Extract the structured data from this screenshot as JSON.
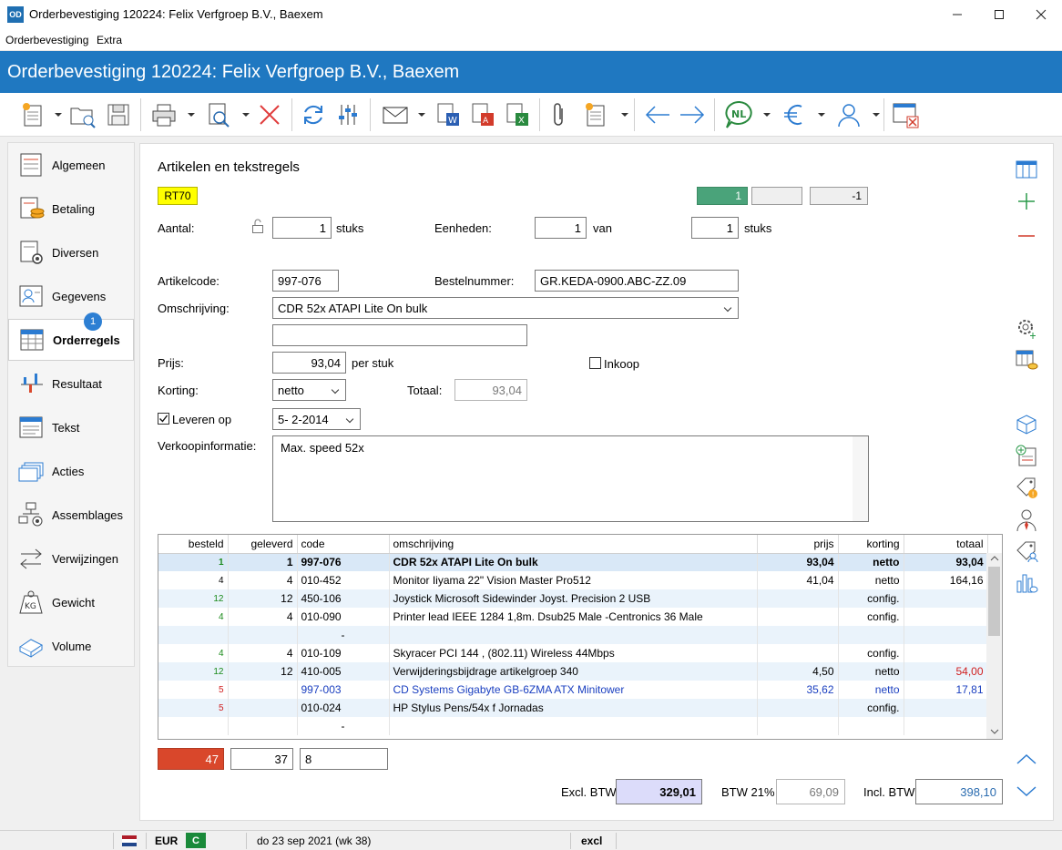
{
  "window": {
    "title": "Orderbevestiging 120224: Felix Verfgroep B.V., Baexem",
    "app_icon": "OD"
  },
  "menu": [
    "Orderbevestiging",
    "Extra"
  ],
  "banner": {
    "title": "Orderbevestiging 120224: Felix Verfgroep B.V., Baexem"
  },
  "toolbar": {
    "language": "NL"
  },
  "sidebar": {
    "items": [
      {
        "label": "Algemeen",
        "icon": "sheet-icon"
      },
      {
        "label": "Betaling",
        "icon": "coins-icon"
      },
      {
        "label": "Diversen",
        "icon": "gear-doc-icon"
      },
      {
        "label": "Gegevens",
        "icon": "contact-card-icon"
      },
      {
        "label": "Orderregels",
        "icon": "table-icon"
      },
      {
        "label": "Resultaat",
        "icon": "chart-icon"
      },
      {
        "label": "Tekst",
        "icon": "text-icon"
      },
      {
        "label": "Acties",
        "icon": "cards-icon"
      },
      {
        "label": "Assemblages",
        "icon": "assembly-icon"
      },
      {
        "label": "Verwijzingen",
        "icon": "arrows-icon"
      },
      {
        "label": "Gewicht",
        "icon": "weight-icon"
      },
      {
        "label": "Volume",
        "icon": "box-icon"
      }
    ],
    "badge": "1"
  },
  "form": {
    "section_title": "Artikelen en tekstregels",
    "tag": "RT70",
    "counters": {
      "current": "1",
      "middle": "",
      "last": "-1"
    },
    "aantal_label": "Aantal:",
    "aantal_value": "1",
    "stuks": "stuks",
    "eenheden_label": "Eenheden:",
    "eenheden_value": "1",
    "van": "van",
    "eenheden_of": "1",
    "artikelcode_label": "Artikelcode:",
    "artikelcode_value": "997-076",
    "bestelnummer_label": "Bestelnummer:",
    "bestelnummer_value": "GR.KEDA-0900.ABC-ZZ.09",
    "omschrijving_label": "Omschrijving:",
    "omschrijving_value": "CDR 52x ATAPI Lite On bulk",
    "omschrijving2_value": "",
    "prijs_label": "Prijs:",
    "prijs_value": "93,04",
    "per_stuk": "per stuk",
    "inkoop_label": "Inkoop",
    "korting_label": "Korting:",
    "korting_value": "netto",
    "totaal_label": "Totaal:",
    "totaal_value": "93,04",
    "leveren_label": "Leveren op",
    "leveren_value": "5-  2-2014",
    "verkoopinfo_label": "Verkoopinformatie:",
    "verkoopinfo_value": "Max. speed 52x"
  },
  "grid": {
    "headers": [
      "besteld",
      "geleverd",
      "code",
      "omschrijving",
      "prijs",
      "korting",
      "totaal"
    ],
    "rows": [
      {
        "besteld": "1",
        "geleverd": "1",
        "code": "997-076",
        "omschrijving": "CDR 52x ATAPI Lite On bulk",
        "prijs": "93,04",
        "korting": "netto",
        "totaal": "93,04",
        "besteld_color": "#1a8a1a",
        "text_color": "#000",
        "totaal_color": "#000"
      },
      {
        "besteld": "4",
        "geleverd": "4",
        "code": "010-452",
        "omschrijving": "Monitor Iiyama 22\" Vision Master Pro512",
        "prijs": "41,04",
        "korting": "netto",
        "totaal": "164,16",
        "besteld_color": "#000",
        "text_color": "#000",
        "totaal_color": "#000"
      },
      {
        "besteld": "12",
        "geleverd": "12",
        "code": "450-106",
        "omschrijving": "Joystick Microsoft Sidewinder Joyst. Precision 2 USB",
        "prijs": "",
        "korting": "config.",
        "totaal": "",
        "besteld_color": "#1a8a1a",
        "text_color": "#000",
        "totaal_color": "#000"
      },
      {
        "besteld": "4",
        "geleverd": "4",
        "code": "010-090",
        "omschrijving": "Printer lead IEEE 1284 1,8m.  Dsub25 Male -Centronics 36 Male",
        "prijs": "",
        "korting": "config.",
        "totaal": "",
        "besteld_color": "#1a8a1a",
        "text_color": "#000",
        "totaal_color": "#000"
      },
      {
        "besteld": "",
        "geleverd": "",
        "code": "-",
        "omschrijving": "",
        "prijs": "",
        "korting": "",
        "totaal": "",
        "besteld_color": "#000",
        "text_color": "#000",
        "totaal_color": "#000"
      },
      {
        "besteld": "4",
        "geleverd": "4",
        "code": "010-109",
        "omschrijving": "Skyracer PCI 144 , (802.11) Wireless 44Mbps",
        "prijs": "",
        "korting": "config.",
        "totaal": "",
        "besteld_color": "#1a8a1a",
        "text_color": "#000",
        "totaal_color": "#000"
      },
      {
        "besteld": "12",
        "geleverd": "12",
        "code": "410-005",
        "omschrijving": "Verwijderingsbijdrage artikelgroep 340",
        "prijs": "4,50",
        "korting": "netto",
        "totaal": "54,00",
        "besteld_color": "#1a8a1a",
        "text_color": "#000",
        "totaal_color": "#d02020"
      },
      {
        "besteld": "5",
        "geleverd": "",
        "code": "997-003",
        "omschrijving": "CD Systems Gigabyte GB-6ZMA ATX Minitower",
        "prijs": "35,62",
        "korting": "netto",
        "totaal": "17,81",
        "besteld_color": "#d02020",
        "text_color": "#1a3fc0",
        "totaal_color": "#1a3fc0"
      },
      {
        "besteld": "5",
        "geleverd": "",
        "code": "010-024",
        "omschrijving": "HP Stylus Pens/54x f Jornadas",
        "prijs": "",
        "korting": "config.",
        "totaal": "",
        "besteld_color": "#d02020",
        "text_color": "#000",
        "totaal_color": "#000"
      },
      {
        "besteld": "",
        "geleverd": "",
        "code": "-",
        "omschrijving": "",
        "prijs": "",
        "korting": "",
        "totaal": "",
        "besteld_color": "#000",
        "text_color": "#000",
        "totaal_color": "#000"
      }
    ]
  },
  "summary": {
    "besteld_total": "47",
    "geleverd_total": "37",
    "count": "8",
    "excl_label": "Excl. BTW",
    "excl_value": "329,01",
    "btw_label": "BTW 21%",
    "btw_value": "69,09",
    "incl_label": "Incl. BTW",
    "incl_value": "398,10"
  },
  "statusbar": {
    "currency": "EUR",
    "mode": "C",
    "date": "do 23 sep 2021 (wk 38)",
    "vat_mode": "excl"
  },
  "colors": {
    "banner": "#1f78c1",
    "counter_active": "#4aa37a",
    "tag": "#ffff00",
    "besteld_total_bg": "#d9472b",
    "excl_bg": "#dcdcfa"
  }
}
